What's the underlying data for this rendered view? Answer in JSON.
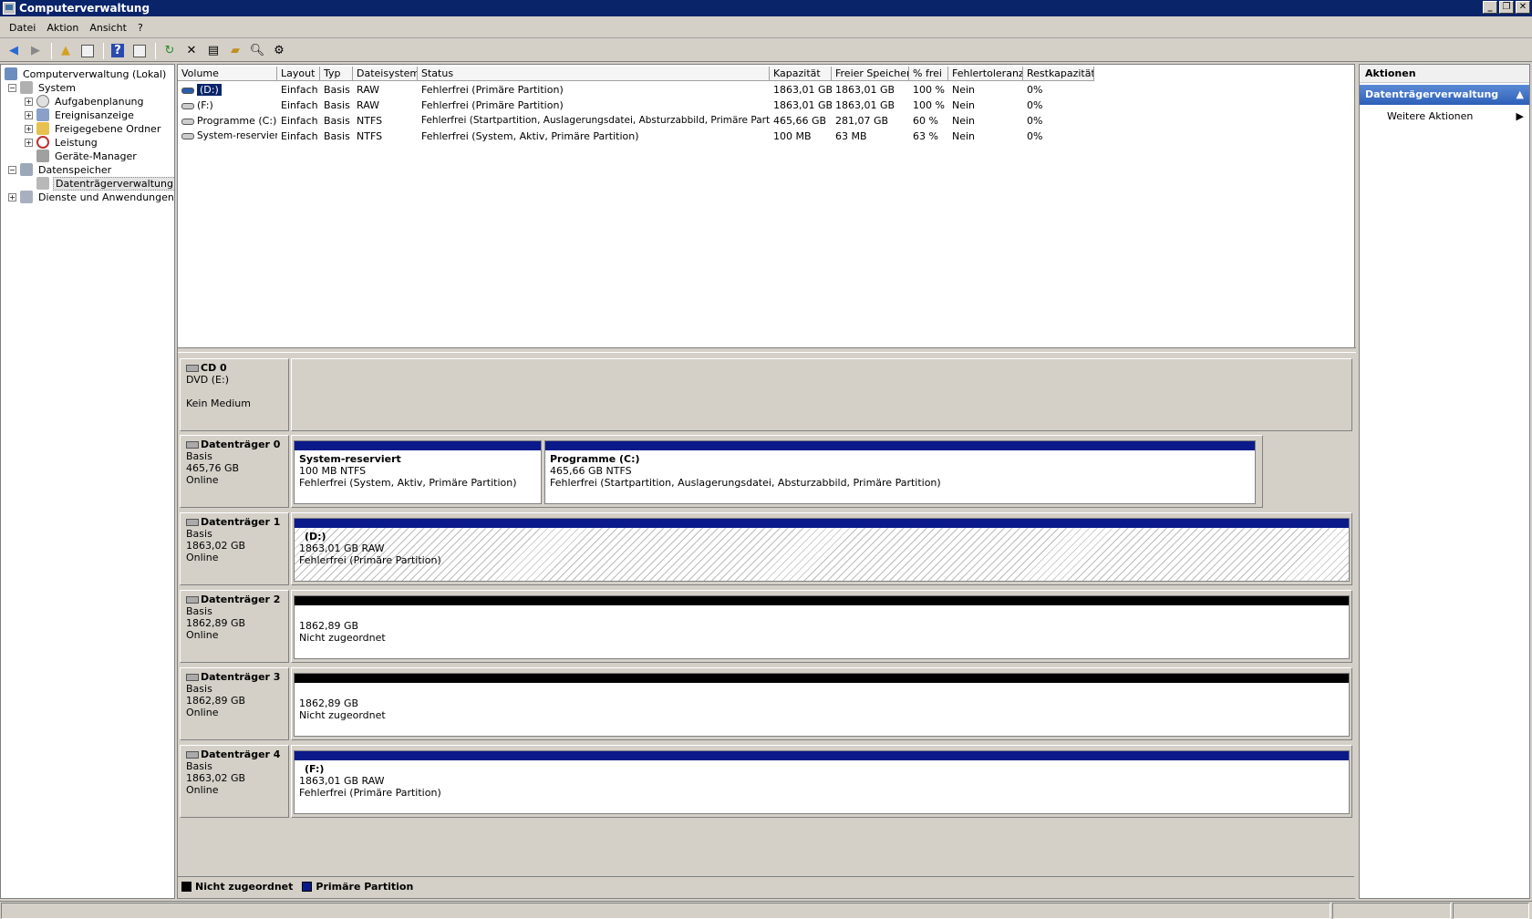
{
  "window": {
    "title": "Computerverwaltung"
  },
  "menu": [
    "Datei",
    "Aktion",
    "Ansicht",
    "?"
  ],
  "tree": [
    {
      "label": "Computerverwaltung (Lokal)",
      "level": 0,
      "expander": ""
    },
    {
      "label": "System",
      "level": 1,
      "expander": "−"
    },
    {
      "label": "Aufgabenplanung",
      "level": 2,
      "expander": "+"
    },
    {
      "label": "Ereignisanzeige",
      "level": 2,
      "expander": "+"
    },
    {
      "label": "Freigegebene Ordner",
      "level": 2,
      "expander": "+"
    },
    {
      "label": "Leistung",
      "level": 2,
      "expander": "+"
    },
    {
      "label": "Geräte-Manager",
      "level": 2,
      "expander": ""
    },
    {
      "label": "Datenspeicher",
      "level": 1,
      "expander": "−"
    },
    {
      "label": "Datenträgerverwaltung",
      "level": 2,
      "expander": "",
      "selected": true
    },
    {
      "label": "Dienste und Anwendungen",
      "level": 1,
      "expander": "+"
    }
  ],
  "volumes": {
    "columns": [
      "Volume",
      "Layout",
      "Typ",
      "Dateisystem",
      "Status",
      "Kapazität",
      "Freier Speicher",
      "% frei",
      "Fehlertoleranz",
      "Restkapazität"
    ],
    "rows": [
      [
        "(D:)",
        "Einfach",
        "Basis",
        "RAW",
        "Fehlerfrei (Primäre Partition)",
        "1863,01 GB",
        "1863,01 GB",
        "100 %",
        "Nein",
        "0%"
      ],
      [
        "(F:)",
        "Einfach",
        "Basis",
        "RAW",
        "Fehlerfrei (Primäre Partition)",
        "1863,01 GB",
        "1863,01 GB",
        "100 %",
        "Nein",
        "0%"
      ],
      [
        "Programme (C:)",
        "Einfach",
        "Basis",
        "NTFS",
        "Fehlerfrei (Startpartition, Auslagerungsdatei, Absturzabbild, Primäre Partition)",
        "465,66 GB",
        "281,07 GB",
        "60 %",
        "Nein",
        "0%"
      ],
      [
        "System-reserviert",
        "Einfach",
        "Basis",
        "NTFS",
        "Fehlerfrei (System, Aktiv, Primäre Partition)",
        "100 MB",
        "63 MB",
        "63 %",
        "Nein",
        "0%"
      ]
    ]
  },
  "disks": [
    {
      "name": "CD 0",
      "lines": [
        "DVD (E:)",
        "",
        "Kein Medium"
      ],
      "partitions": []
    },
    {
      "name": "Datenträger 0",
      "lines": [
        "Basis",
        "465,76 GB",
        "Online"
      ],
      "partitions": [
        {
          "title": "System-reserviert",
          "size": "100 MB NTFS",
          "status": "Fehlerfrei (System, Aktiv, Primäre Partition)",
          "kind": "primary"
        },
        {
          "title": "Programme  (C:)",
          "size": "465,66 GB NTFS",
          "status": "Fehlerfrei (Startpartition, Auslagerungsdatei, Absturzabbild, Primäre Partition)",
          "kind": "primary"
        }
      ]
    },
    {
      "name": "Datenträger 1",
      "lines": [
        "Basis",
        "1863,02 GB",
        "Online"
      ],
      "partitions": [
        {
          "title": "(D:)",
          "size": "1863,01 GB RAW",
          "status": "Fehlerfrei (Primäre Partition)",
          "kind": "primary",
          "hatched": true
        }
      ]
    },
    {
      "name": "Datenträger 2",
      "lines": [
        "Basis",
        "1862,89 GB",
        "Online"
      ],
      "partitions": [
        {
          "title": "",
          "size": "1862,89 GB",
          "status": "Nicht zugeordnet",
          "kind": "unallocated"
        }
      ]
    },
    {
      "name": "Datenträger 3",
      "lines": [
        "Basis",
        "1862,89 GB",
        "Online"
      ],
      "partitions": [
        {
          "title": "",
          "size": "1862,89 GB",
          "status": "Nicht zugeordnet",
          "kind": "unallocated"
        }
      ]
    },
    {
      "name": "Datenträger 4",
      "lines": [
        "Basis",
        "1863,02 GB",
        "Online"
      ],
      "partitions": [
        {
          "title": "(F:)",
          "size": "1863,01 GB RAW",
          "status": "Fehlerfrei (Primäre Partition)",
          "kind": "primary"
        }
      ]
    }
  ],
  "legend": [
    {
      "label": "Nicht zugeordnet",
      "color": "#000000"
    },
    {
      "label": "Primäre Partition",
      "color": "#0a1a8a"
    }
  ],
  "actions": {
    "header": "Aktionen",
    "section": "Datenträgerverwaltung",
    "items": [
      "Weitere Aktionen"
    ]
  }
}
